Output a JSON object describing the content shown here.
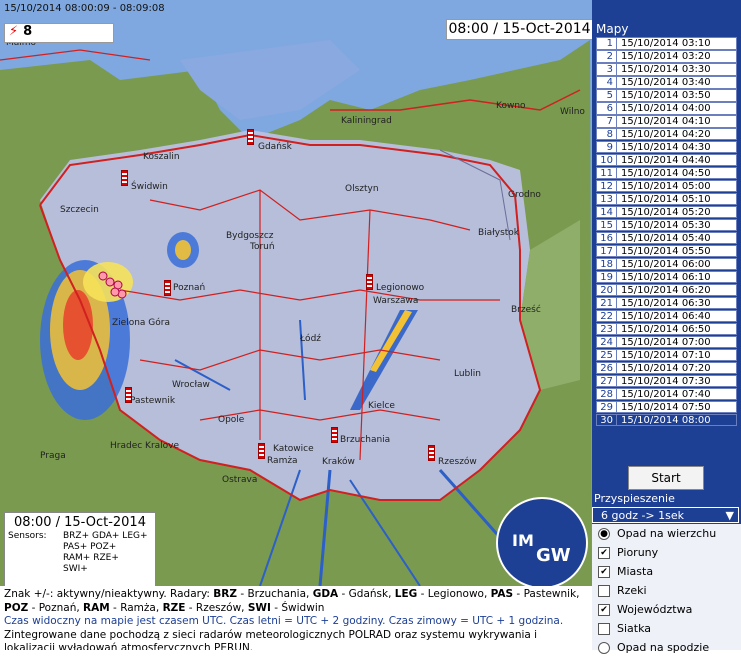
{
  "map": {
    "utc_range": "15/10/2014 08:00:09 - 08:09:08",
    "lightning_count": "8",
    "overlay_city_malmo": "Malmo",
    "timestamp": "08:00 / 15-Oct-2014",
    "cities": [
      "Gdańsk",
      "Kaliningrad",
      "Kowno",
      "Wilno",
      "Koszalin",
      "Świdwin",
      "Szczecin",
      "Olsztyn",
      "Grodno",
      "Bydgoszcz",
      "Toruń",
      "Białystok",
      "Legionowo",
      "Warszawa",
      "Poznań",
      "Brześć",
      "Łódź",
      "Zielona Góra",
      "Lublin",
      "Wrocław",
      "Pastewnik",
      "Kielce",
      "Brzuchania",
      "Opole",
      "Hradec Kralove",
      "Katowice",
      "Ramża",
      "Praga",
      "Kraków",
      "Rzeszów",
      "Ostrava"
    ],
    "legend": {
      "time": "08:00 / 15-Oct-2014",
      "sensors_label": "Sensors:",
      "lines": [
        "BRZ+ GDA+ LEG+",
        "PAS+ POZ+",
        "RAM+ RZE+",
        "SWI+"
      ]
    },
    "logo": {
      "top": "IM",
      "bottom": "GW"
    }
  },
  "info": {
    "line1_prefix": "Znak +/-: aktywny/nieaktywny.  Radary: ",
    "radars": [
      {
        "code": "BRZ",
        "name": "Brzuchania"
      },
      {
        "code": "GDA",
        "name": "Gdańsk"
      },
      {
        "code": "LEG",
        "name": "Legionowo"
      },
      {
        "code": "PAS",
        "name": "Pastewnik"
      },
      {
        "code": "POZ",
        "name": "Poznań"
      },
      {
        "code": "RAM",
        "name": "Ramża"
      },
      {
        "code": "RZE",
        "name": "Rzeszów"
      },
      {
        "code": "SWI",
        "name": "Świdwin"
      }
    ],
    "line_utc": "Czas widoczny na mapie jest czasem UTC. Czas letni = UTC + 2 godziny. Czas zimowy = UTC + 1 godzina.",
    "line_source": "Zintegrowane dane pochodzą z sieci radarów meteorologicznych POLRAD oraz systemu wykrywania i lokalizacji wyładowań atmosferycznych PERUN."
  },
  "panel": {
    "maps_label": "Mapy",
    "maps": [
      "15/10/2014 03:10",
      "15/10/2014 03:20",
      "15/10/2014 03:30",
      "15/10/2014 03:40",
      "15/10/2014 03:50",
      "15/10/2014 04:00",
      "15/10/2014 04:10",
      "15/10/2014 04:20",
      "15/10/2014 04:30",
      "15/10/2014 04:40",
      "15/10/2014 04:50",
      "15/10/2014 05:00",
      "15/10/2014 05:10",
      "15/10/2014 05:20",
      "15/10/2014 05:30",
      "15/10/2014 05:40",
      "15/10/2014 05:50",
      "15/10/2014 06:00",
      "15/10/2014 06:10",
      "15/10/2014 06:20",
      "15/10/2014 06:30",
      "15/10/2014 06:40",
      "15/10/2014 06:50",
      "15/10/2014 07:00",
      "15/10/2014 07:10",
      "15/10/2014 07:20",
      "15/10/2014 07:30",
      "15/10/2014 07:40",
      "15/10/2014 07:50",
      "15/10/2014 08:00"
    ],
    "selected_index": 30,
    "start_label": "Start",
    "speed_label": "Przyspieszenie",
    "speed_value": "6 godz -> 1sek",
    "options": [
      {
        "label": "Opad na wierzchu",
        "type": "radio",
        "checked": true
      },
      {
        "label": "Pioruny",
        "type": "checkbox",
        "checked": true
      },
      {
        "label": "Miasta",
        "type": "checkbox",
        "checked": true
      },
      {
        "label": "Rzeki",
        "type": "checkbox",
        "checked": false
      },
      {
        "label": "Województwa",
        "type": "checkbox",
        "checked": true
      },
      {
        "label": "Siatka",
        "type": "checkbox",
        "checked": false
      },
      {
        "label": "Opad na spodzie",
        "type": "radio",
        "checked": false
      }
    ]
  }
}
